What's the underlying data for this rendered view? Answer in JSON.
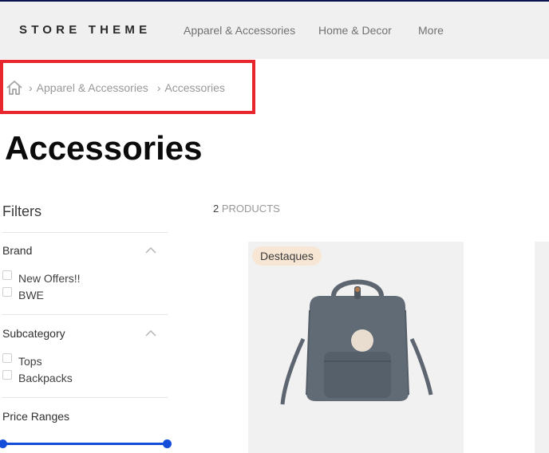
{
  "header": {
    "logo": "STORE THEME",
    "nav": [
      "Apparel & Accessories",
      "Home & Decor",
      "More"
    ]
  },
  "breadcrumb": {
    "icon": "home-icon",
    "items": [
      "Apparel & Accessories",
      "Accessories"
    ],
    "separator": "›"
  },
  "page": {
    "title": "Accessories"
  },
  "filters": {
    "title": "Filters",
    "brand": {
      "label": "Brand",
      "options": [
        "New Offers!!",
        "BWE"
      ]
    },
    "subcategory": {
      "label": "Subcategory",
      "options": [
        "Tops",
        "Backpacks"
      ]
    },
    "price": {
      "label": "Price Ranges"
    }
  },
  "results": {
    "count": "2",
    "label": "PRODUCTS"
  },
  "products": [
    {
      "badge": "Destaques",
      "image": "backpack-image"
    }
  ],
  "colors": {
    "accent": "#134cd8",
    "highlight": "#e8262e",
    "badge": "#f8e6d4"
  }
}
